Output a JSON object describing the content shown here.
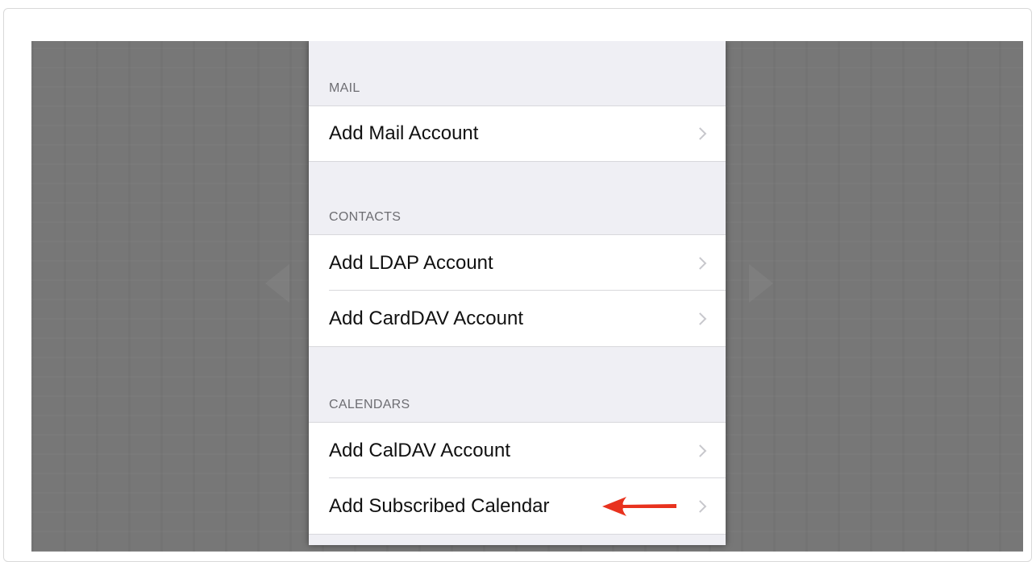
{
  "sections": [
    {
      "header": "MAIL",
      "items": [
        {
          "label": "Add Mail Account"
        }
      ]
    },
    {
      "header": "CONTACTS",
      "items": [
        {
          "label": "Add LDAP Account"
        },
        {
          "label": "Add CardDAV Account"
        }
      ]
    },
    {
      "header": "CALENDARS",
      "items": [
        {
          "label": "Add CalDAV Account"
        },
        {
          "label": "Add Subscribed Calendar"
        }
      ]
    }
  ],
  "colors": {
    "background": "#777777",
    "group_background": "#efeff4",
    "row_background": "#ffffff",
    "header_text": "#6d6d72",
    "chevron": "#c7c7cc",
    "annotation_arrow": "#e8321e"
  },
  "icons": {
    "chevron": "chevron-right-icon",
    "annotation": "red-arrow-icon"
  }
}
